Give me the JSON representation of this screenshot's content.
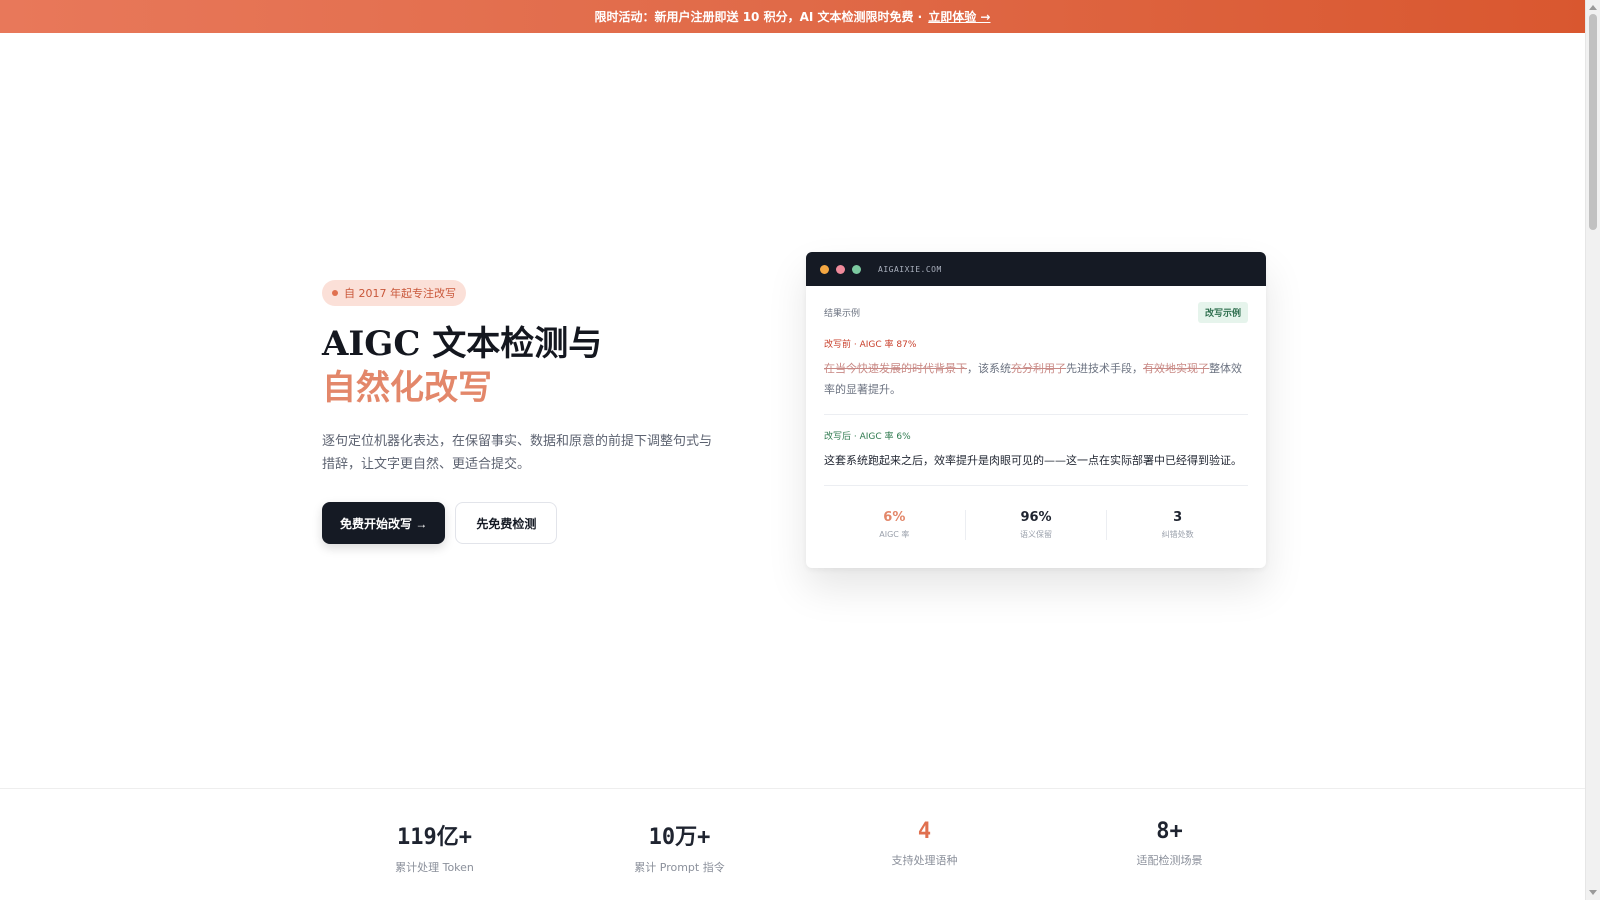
{
  "promo": {
    "text": "限时活动：新用户注册即送 10 积分，AI 文本检测限时免费 ·",
    "link": "立即体验 →"
  },
  "hero": {
    "badge": "自 2017 年起专注改写",
    "title_line1": "AIGC 文本检测与",
    "title_line2": "自然化改写",
    "description": "逐句定位机器化表达，在保留事实、数据和原意的前提下调整句式与措辞，让文字更自然、更适合提交。",
    "primary_button": "免费开始改写 →",
    "secondary_button": "先免费检测"
  },
  "preview": {
    "url": "AIGAIXIE.COM",
    "header_label": "结果示例",
    "tag": "改写示例",
    "before": {
      "label": "改写前 · AIGC 率 87%",
      "struck_1": "在当今快速发展的时代背景下",
      "plain_1": "，该系统",
      "struck_2": "充分利用了",
      "plain_2": "先进技术手段，",
      "struck_3": "有效地实现了",
      "plain_3": "整体效率的显著提升。"
    },
    "after": {
      "label": "改写后 · AIGC 率 6%",
      "text": "这套系统跑起来之后，效率提升是肉眼可见的——这一点在实际部署中已经得到验证。"
    },
    "stats": [
      {
        "value": "6%",
        "label": "AIGC 率"
      },
      {
        "value": "96%",
        "label": "语义保留"
      },
      {
        "value": "3",
        "label": "纠错处数"
      }
    ]
  },
  "bottom_stats": [
    {
      "value": "119亿+",
      "label": "累计处理 Token"
    },
    {
      "value": "10万+",
      "label": "累计 Prompt 指令"
    },
    {
      "value": "4",
      "label": "支持处理语种"
    },
    {
      "value": "8+",
      "label": "适配检测场景"
    }
  ],
  "colors": {
    "accent": "#e3876a",
    "banner": "#e06a48",
    "dark": "#151a24"
  }
}
